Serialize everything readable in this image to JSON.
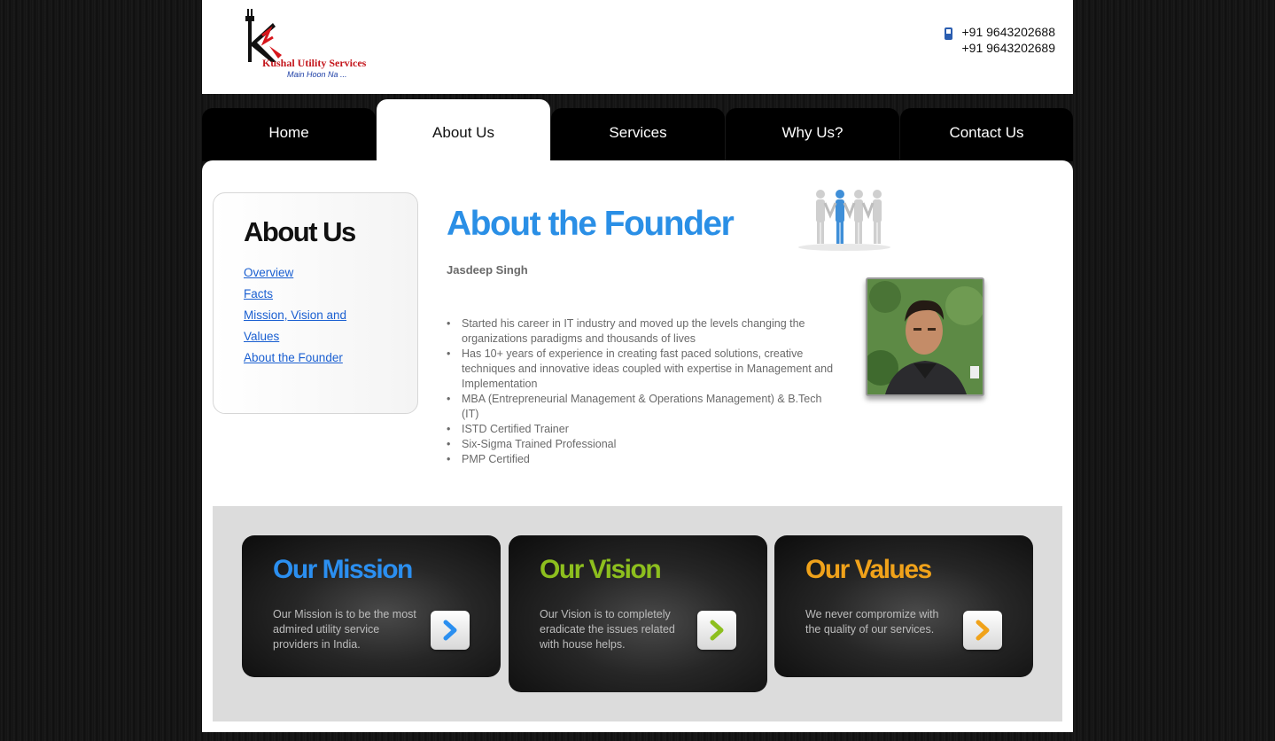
{
  "header": {
    "logo_name": "Kushal Utility Services",
    "logo_tagline": "Main Hoon Na ...",
    "phones": [
      "+91 9643202688",
      "+91 9643202689"
    ],
    "phone_icon": "mobile-phone-icon"
  },
  "nav": {
    "tabs": [
      {
        "label": "Home"
      },
      {
        "label": "About Us"
      },
      {
        "label": "Services"
      },
      {
        "label": "Why Us?"
      },
      {
        "label": "Contact Us"
      }
    ],
    "active_tab": "About Us"
  },
  "sidebar": {
    "title": "About Us",
    "links": [
      "Overview",
      "Facts",
      "Mission, Vision and Values",
      "About the Founder"
    ]
  },
  "main": {
    "title": "About the Founder",
    "founder_name": "Jasdeep Singh",
    "bullets": [
      "Started his career in IT industry and moved up the levels changing the organizations paradigms and thousands of lives",
      "Has 10+ years of experience in creating fast paced solutions, creative techniques and innovative ideas coupled with expertise in Management and Implementation",
      "MBA (Entrepreneurial Management & Operations Management) & B.Tech (IT)",
      "ISTD Certified Trainer",
      "Six-Sigma Trained Professional",
      "PMP Certified"
    ]
  },
  "cards": [
    {
      "title": "Our Mission",
      "text": "Our Mission is to be the most admired utility service providers in India.",
      "color": "#2b8ff0",
      "icon": "chevron-right-icon"
    },
    {
      "title": "Our Vision",
      "text": "Our Vision is to completely eradicate the issues related with house helps.",
      "color": "#8dbf1e",
      "icon": "chevron-right-icon"
    },
    {
      "title": "Our Values",
      "text": "We never compromize with the quality of our services.",
      "color": "#f0a21a",
      "icon": "chevron-right-icon"
    }
  ],
  "colors": {
    "accent_blue": "#2a8fe6",
    "link": "#1a5fd1",
    "brand_red": "#c4161c"
  }
}
